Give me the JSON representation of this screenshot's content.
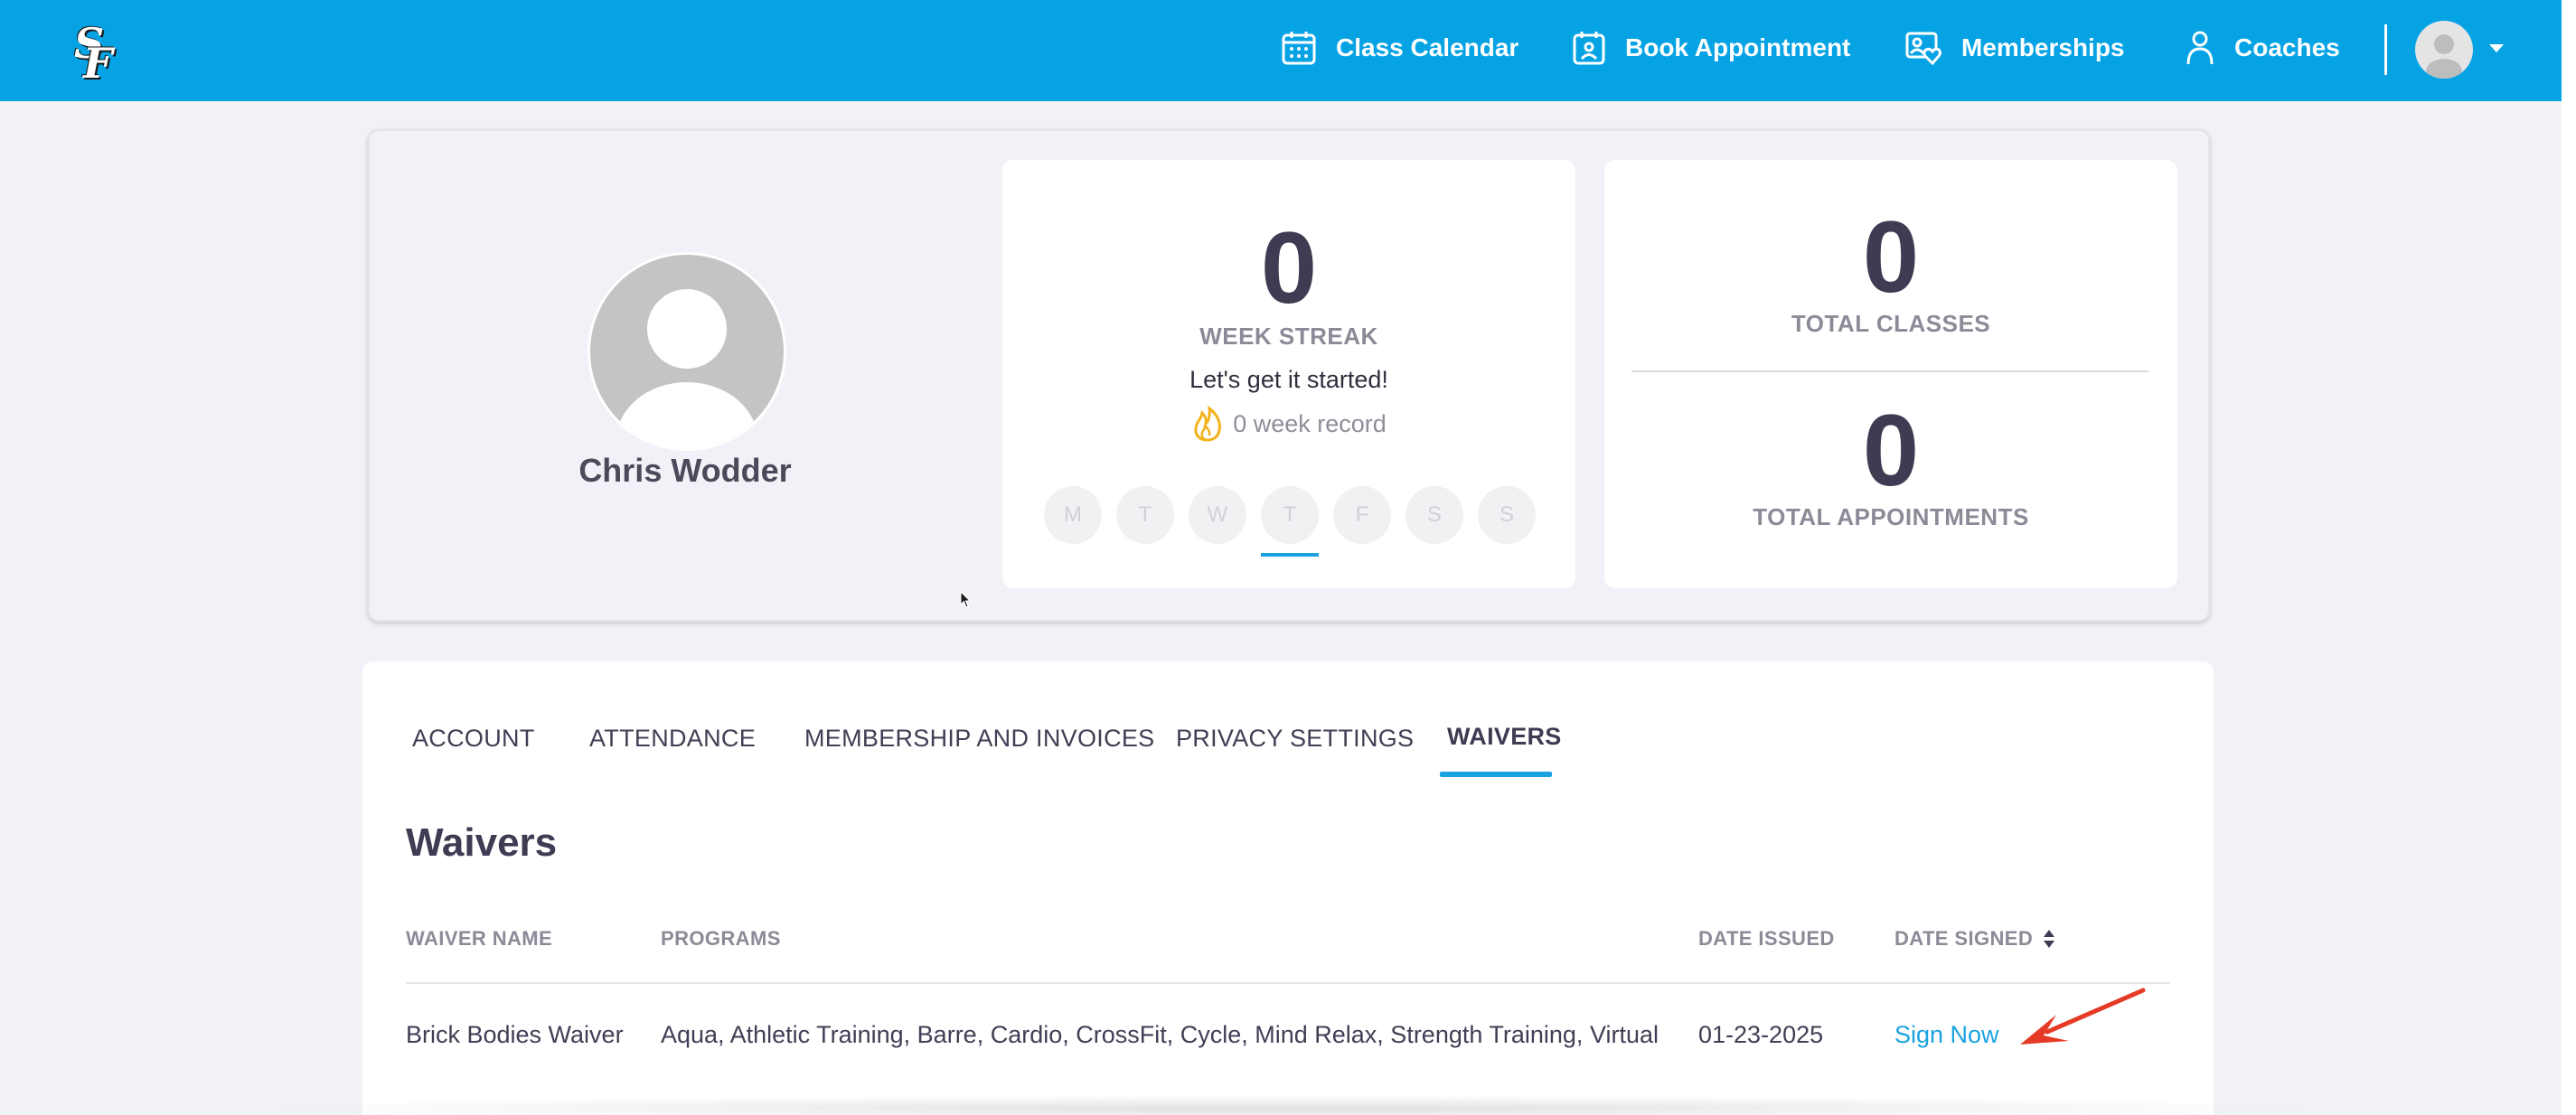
{
  "nav": {
    "logo_text": "SF",
    "items": [
      {
        "label": "Class Calendar",
        "icon": "calendar-grid-icon"
      },
      {
        "label": "Book Appointment",
        "icon": "calendar-person-icon"
      },
      {
        "label": "Memberships",
        "icon": "card-heart-icon"
      },
      {
        "label": "Coaches",
        "icon": "person-outline-icon"
      }
    ],
    "user_menu_icon": "chevron-down-icon"
  },
  "profile": {
    "name": "Chris Wodder",
    "avatar_icon": "default-avatar-icon"
  },
  "streak": {
    "value": "0",
    "label": "WEEK STREAK",
    "message": "Let's get it started!",
    "record": "0 week record",
    "record_icon": "flame-icon",
    "days": [
      "M",
      "T",
      "W",
      "T",
      "F",
      "S",
      "S"
    ],
    "today_index": 3
  },
  "stats": {
    "total_classes_value": "0",
    "total_classes_label": "TOTAL CLASSES",
    "total_appointments_value": "0",
    "total_appointments_label": "TOTAL APPOINTMENTS"
  },
  "tabs": [
    {
      "label": "ACCOUNT",
      "active": false
    },
    {
      "label": "ATTENDANCE",
      "active": false
    },
    {
      "label": "MEMBERSHIP AND INVOICES",
      "active": false
    },
    {
      "label": "PRIVACY SETTINGS",
      "active": false
    },
    {
      "label": "WAIVERS",
      "active": true
    }
  ],
  "waivers": {
    "title": "Waivers",
    "columns": [
      "WAIVER NAME",
      "PROGRAMS",
      "DATE ISSUED",
      "DATE SIGNED"
    ],
    "sort_icon": "sort-arrows-icon",
    "rows": [
      {
        "name": "Brick Bodies Waiver",
        "programs": "Aqua, Athletic Training, Barre, Cardio, CrossFit, Cycle, Mind Relax, Strength Training, Virtual",
        "date_issued": "01-23-2025",
        "date_signed_action": "Sign Now"
      }
    ]
  },
  "colors": {
    "brand": "#05a3e4",
    "accent": "#1aa2e0",
    "annotation_arrow": "#e53a25",
    "flame": "#f2b21b"
  }
}
